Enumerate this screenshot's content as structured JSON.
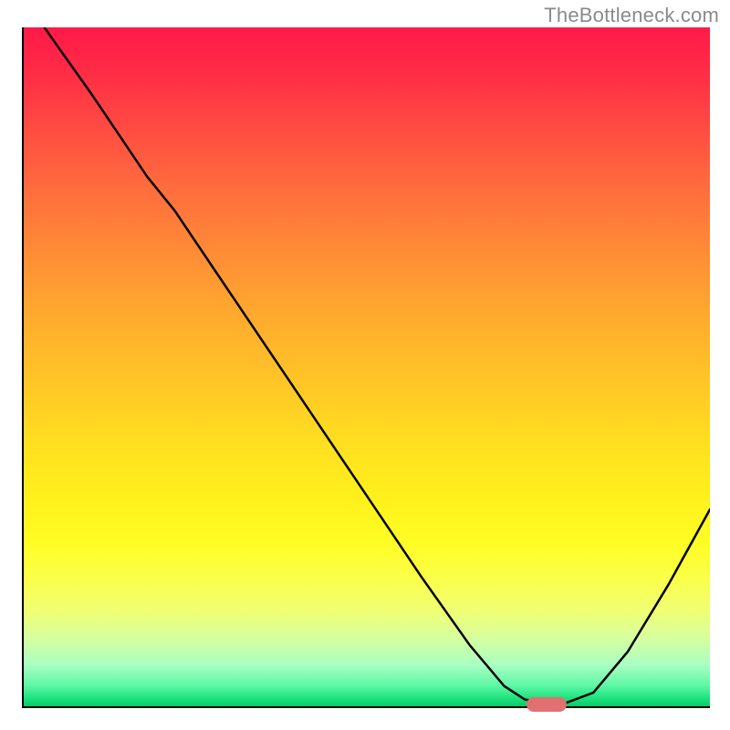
{
  "attribution": "TheBottleneck.com",
  "chart_data": {
    "type": "line",
    "title": "",
    "xlabel": "",
    "ylabel": "",
    "xlim": [
      0,
      100
    ],
    "ylim": [
      0,
      100
    ],
    "curve": {
      "x": [
        3,
        10,
        18,
        22,
        28,
        38,
        48,
        58,
        65,
        70,
        73,
        76,
        79,
        83,
        88,
        94,
        100
      ],
      "y": [
        100,
        90,
        78,
        73,
        64,
        49,
        34,
        19,
        9,
        3,
        1,
        0.5,
        0.5,
        2,
        8,
        18,
        29
      ]
    },
    "marker": {
      "x": 76,
      "y": 0.5
    },
    "background_gradient": {
      "top": "#ff1a49",
      "mid": "#ffd024",
      "bottom": "#0bc968"
    }
  }
}
